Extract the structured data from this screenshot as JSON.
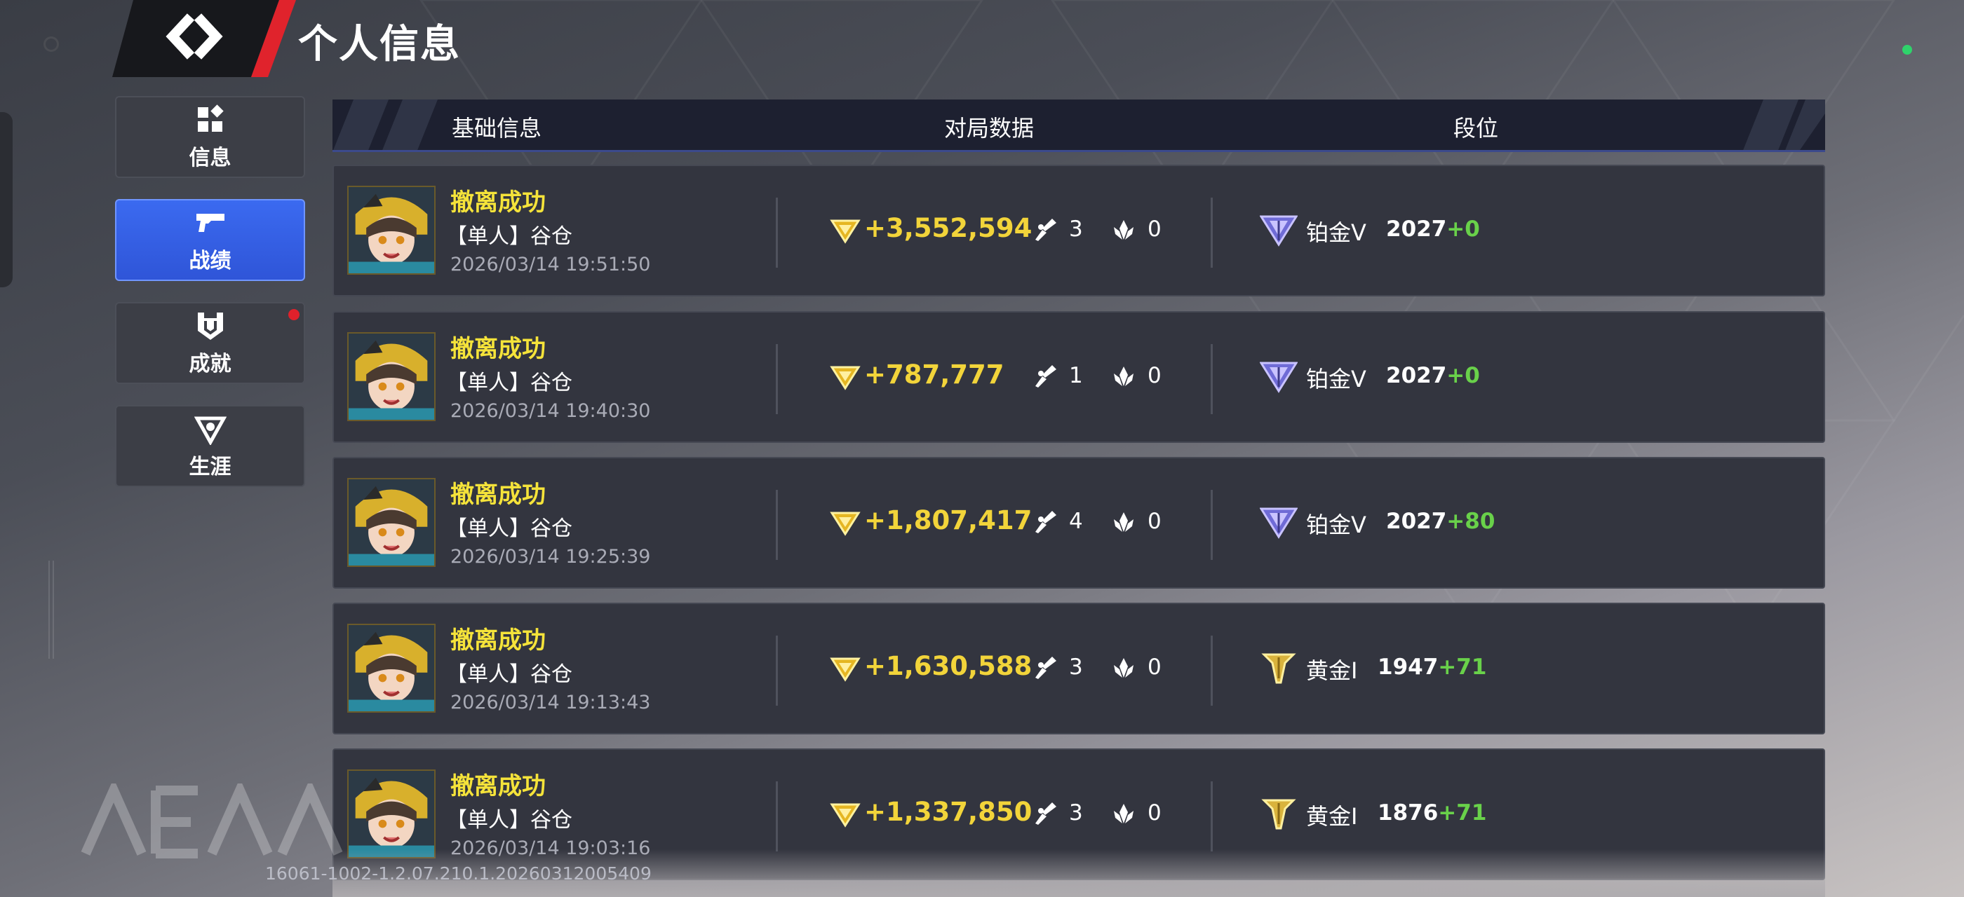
{
  "header": {
    "title": "个人信息",
    "back_icon": "back-chevron-icon"
  },
  "nav": [
    {
      "label": "信息",
      "icon": "grid-icon",
      "active": false
    },
    {
      "label": "战绩",
      "icon": "pistol-icon",
      "active": true
    },
    {
      "label": "成就",
      "icon": "badge-icon",
      "active": false,
      "notification": true
    },
    {
      "label": "生涯",
      "icon": "career-icon",
      "active": false
    }
  ],
  "table": {
    "columns": [
      "基础信息",
      "对局数据",
      "段位"
    ],
    "rows": [
      {
        "result": "撤离成功",
        "mode": "【单人】谷仓",
        "time": "2026/03/14 19:51:50",
        "gold": "+3,552,594",
        "kills": "3",
        "assists": "0",
        "rank": "铂金V",
        "rank_tier": "platinum",
        "score": "2027",
        "delta": "+0"
      },
      {
        "result": "撤离成功",
        "mode": "【单人】谷仓",
        "time": "2026/03/14 19:40:30",
        "gold": "+787,777",
        "kills": "1",
        "assists": "0",
        "rank": "铂金V",
        "rank_tier": "platinum",
        "score": "2027",
        "delta": "+0"
      },
      {
        "result": "撤离成功",
        "mode": "【单人】谷仓",
        "time": "2026/03/14 19:25:39",
        "gold": "+1,807,417",
        "kills": "4",
        "assists": "0",
        "rank": "铂金V",
        "rank_tier": "platinum",
        "score": "2027",
        "delta": "+80"
      },
      {
        "result": "撤离成功",
        "mode": "【单人】谷仓",
        "time": "2026/03/14 19:13:43",
        "gold": "+1,630,588",
        "kills": "3",
        "assists": "0",
        "rank": "黄金I",
        "rank_tier": "gold",
        "score": "1947",
        "delta": "+71"
      },
      {
        "result": "撤离成功",
        "mode": "【单人】谷仓",
        "time": "2026/03/14 19:03:16",
        "gold": "+1,337,850",
        "kills": "3",
        "assists": "0",
        "rank": "黄金I",
        "rank_tier": "gold",
        "score": "1876",
        "delta": "+71"
      }
    ]
  },
  "footer": {
    "version": "16061-1002-1.2.07.210.1.20260312005409"
  },
  "colors": {
    "accent": "#2f55d8",
    "result": "#f5e33a",
    "gold": "#f2d43a",
    "delta": "#69d14a",
    "notification": "#e0212b"
  }
}
